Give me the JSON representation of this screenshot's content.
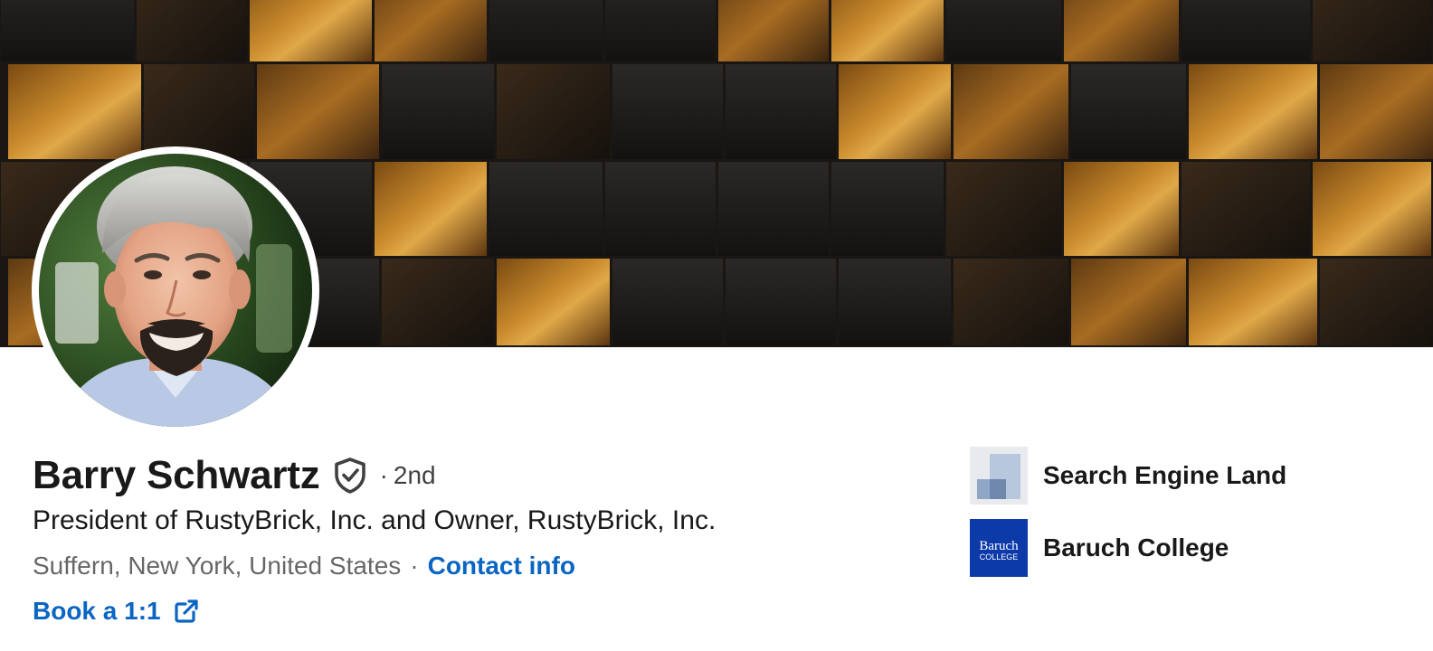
{
  "profile": {
    "name": "Barry Schwartz",
    "degree": "2nd",
    "headline": "President of RustyBrick, Inc. and Owner, RustyBrick, Inc.",
    "location": "Suffern, New York, United States",
    "contact_label": "Contact info",
    "book_label": "Book a 1:1"
  },
  "organizations": [
    {
      "name": "Search Engine Land",
      "logo": "search-engine-land-logo"
    },
    {
      "name": "Baruch College",
      "logo": "baruch-college-logo",
      "logo_text_top": "Baruch",
      "logo_text_bottom": "COLLEGE"
    }
  ],
  "colors": {
    "link": "#0a66c2",
    "baruch_blue": "#0d3aa9"
  },
  "icons": {
    "verified": "shield-check-icon",
    "external": "external-link-icon"
  }
}
